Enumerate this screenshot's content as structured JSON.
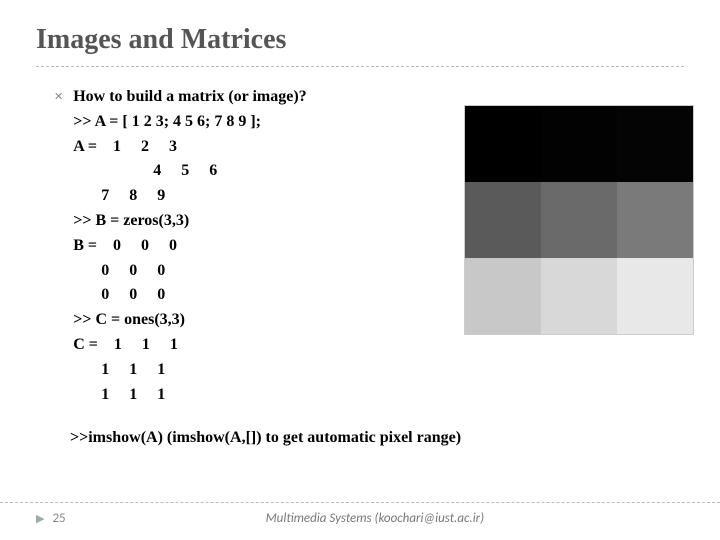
{
  "title": "Images and Matrices",
  "bullet_heading": "How to build a matrix (or image)?",
  "code_block": ">> A = [ 1 2 3; 4 5 6; 7 8 9 ];\nA =    1     2     3\n                    4     5     6\n       7     8     9\n>> B = zeros(3,3)\nB =    0     0     0\n       0     0     0\n       0     0     0\n>> C = ones(3,3)\nC =    1     1     1\n       1     1     1\n       1     1     1",
  "imshow_line": ">>imshow(A)  (imshow(A,[]) to get automatic pixel range)",
  "matrix_image": {
    "rows": 3,
    "cols": 3,
    "cell_colors": [
      "#000000",
      "#020202",
      "#040404",
      "#5a5a5a",
      "#6a6a6a",
      "#7a7a7a",
      "#c8c8c8",
      "#d8d8d8",
      "#e8e8e8"
    ]
  },
  "footer": {
    "page": "25",
    "text": "Multimedia Systems (koochari@iust.ac.ir)"
  }
}
